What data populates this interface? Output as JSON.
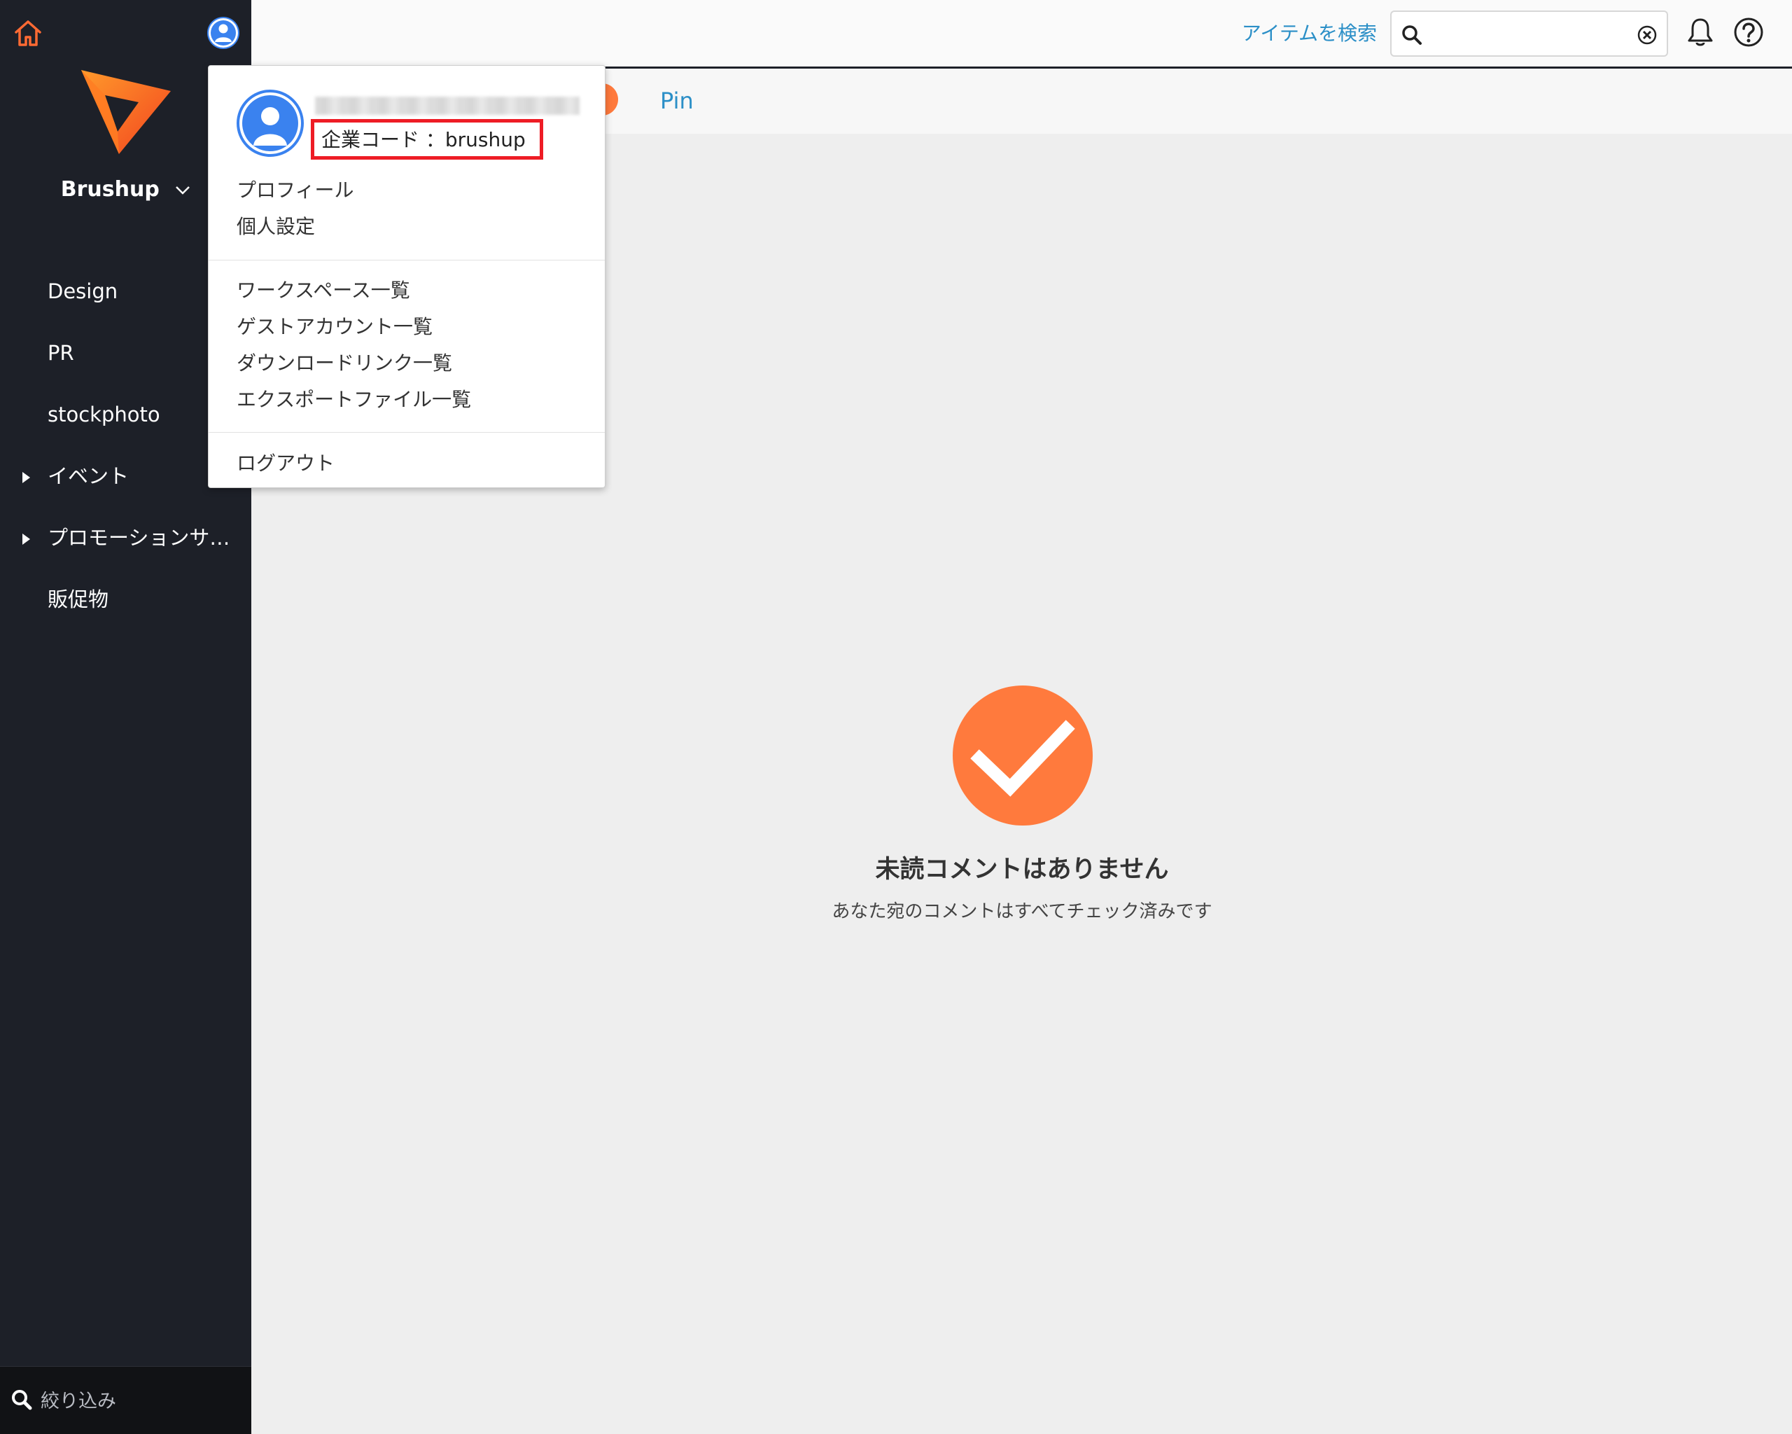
{
  "sidebar": {
    "workspace_name": "Brushup",
    "items": [
      {
        "label": "Design",
        "expandable": false
      },
      {
        "label": "PR",
        "expandable": false
      },
      {
        "label": "stockphoto",
        "expandable": false
      },
      {
        "label": "イベント",
        "expandable": true
      },
      {
        "label": "プロモーションサ…",
        "expandable": true
      },
      {
        "label": "販促物",
        "expandable": false
      }
    ],
    "filter_placeholder": "絞り込み"
  },
  "header": {
    "search_link": "アイテムを検索",
    "search_value": ""
  },
  "subbar": {
    "tab_pin": "Pin"
  },
  "empty_state": {
    "title": "未読コメントはありません",
    "subtitle": "あなた宛のコメントはすべてチェック済みです"
  },
  "dropdown": {
    "company_code": "企業コード ：brushup",
    "profile_items": [
      "プロフィール",
      "個人設定"
    ],
    "list_items": [
      "ワークスペース一覧",
      "ゲストアカウント一覧",
      "ダウンロードリンク一覧",
      "エクスポートファイル一覧"
    ],
    "logout": "ログアウト"
  },
  "colors": {
    "sidebar_bg": "#1d2028",
    "accent_orange": "#ff7a3d",
    "link_blue": "#2b8fc7",
    "avatar_blue": "#3a82ef",
    "highlight_red": "#ee1c25"
  },
  "icons": [
    "home-icon",
    "user-avatar-icon",
    "brushup-logo",
    "chevron-down-icon",
    "search-icon",
    "clear-icon",
    "bell-icon",
    "help-icon",
    "check-icon",
    "caret-right-icon"
  ]
}
